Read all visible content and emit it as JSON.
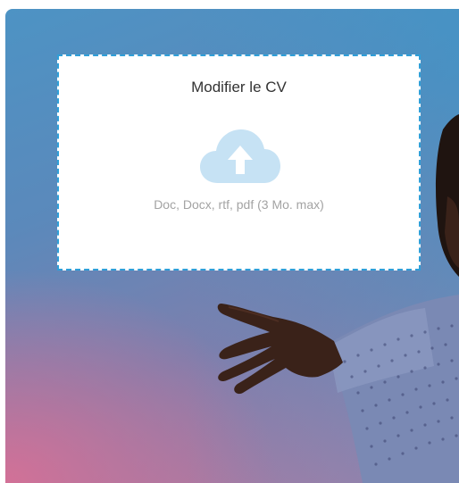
{
  "upload": {
    "title": "Modifier le CV",
    "hint": "Doc, Docx, rtf, pdf (3 Mo. max)",
    "icon": "cloud-upload-icon"
  },
  "colors": {
    "dashed_border": "#2f9fd8",
    "cloud": "#c6e2f4",
    "title_text": "#333333",
    "hint_text": "#a3a3a3"
  }
}
